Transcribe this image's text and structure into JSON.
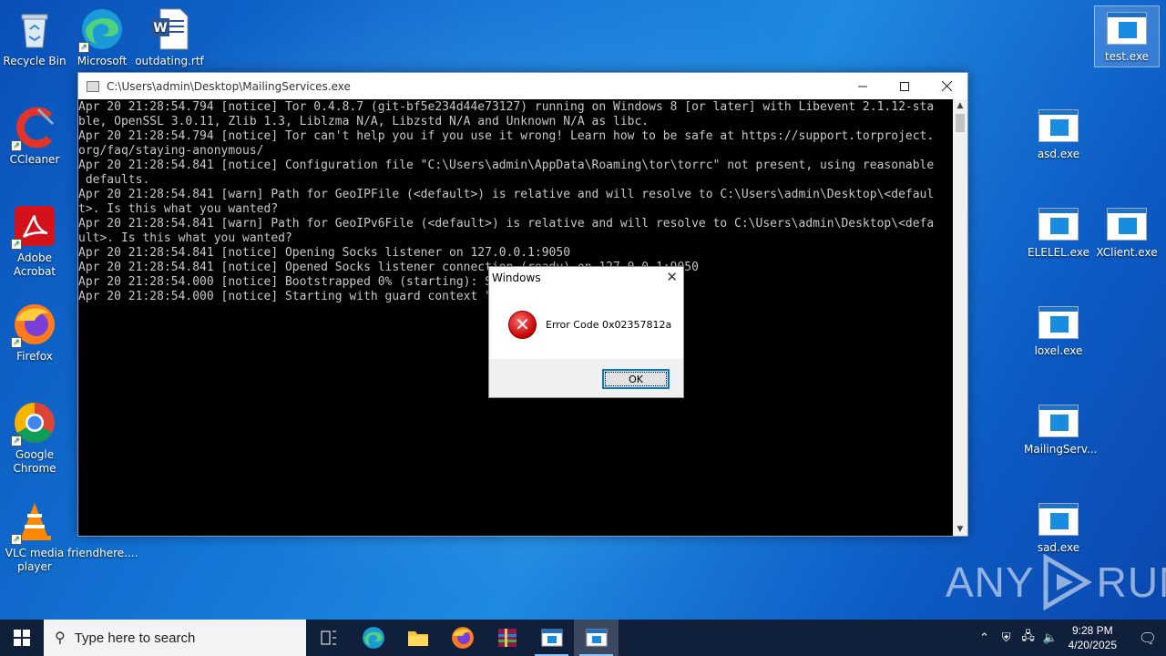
{
  "desktop": {
    "icons_left": [
      {
        "label": "Recycle Bin",
        "icon": "recycle-bin-icon"
      },
      {
        "label": "Microsoft Edge",
        "icon": "edge-icon"
      },
      {
        "label": "outdating.rtf",
        "icon": "word-document-icon"
      },
      {
        "label": "CCleaner",
        "icon": "ccleaner-icon"
      },
      {
        "label": "Adobe Acrobat",
        "icon": "acrobat-icon"
      },
      {
        "label": "Firefox",
        "icon": "firefox-icon"
      },
      {
        "label": "Google Chrome",
        "icon": "chrome-icon"
      },
      {
        "label": "VLC media player",
        "icon": "vlc-icon"
      },
      {
        "label": "friendhere....",
        "icon": "file-icon"
      }
    ],
    "icons_right": [
      {
        "label": "test.exe"
      },
      {
        "label": "asd.exe"
      },
      {
        "label": "ELELEL.exe"
      },
      {
        "label": "XClient.exe"
      },
      {
        "label": "loxel.exe"
      },
      {
        "label": "MailingServ..."
      },
      {
        "label": "sad.exe"
      }
    ]
  },
  "console": {
    "title": "C:\\Users\\admin\\Desktop\\MailingServices.exe",
    "lines": [
      "Apr 20 21:28:54.794 [notice] Tor 0.4.8.7 (git-bf5e234d44e73127) running on Windows 8 [or later] with Libevent 2.1.12-sta",
      "ble, OpenSSL 3.0.11, Zlib 1.3, Liblzma N/A, Libzstd N/A and Unknown N/A as libc.",
      "Apr 20 21:28:54.794 [notice] Tor can't help you if you use it wrong! Learn how to be safe at https://support.torproject.",
      "org/faq/staying-anonymous/",
      "Apr 20 21:28:54.841 [notice] Configuration file \"C:\\Users\\admin\\AppData\\Roaming\\tor\\torrc\" not present, using reasonable",
      " defaults.",
      "Apr 20 21:28:54.841 [warn] Path for GeoIPFile (<default>) is relative and will resolve to C:\\Users\\admin\\Desktop\\<defaul",
      "t>. Is this what you wanted?",
      "Apr 20 21:28:54.841 [warn] Path for GeoIPv6File (<default>) is relative and will resolve to C:\\Users\\admin\\Desktop\\<defa",
      "ult>. Is this what you wanted?",
      "Apr 20 21:28:54.841 [notice] Opening Socks listener on 127.0.0.1:9050",
      "Apr 20 21:28:54.841 [notice] Opened Socks listener connection (ready) on 127.0.0.1:9050",
      "Apr 20 21:28:54.000 [notice] Bootstrapped 0% (starting): Starting",
      "Apr 20 21:28:54.000 [notice] Starting with guard context \"default\""
    ]
  },
  "dialog": {
    "title": "Windows",
    "close": "✕",
    "message": "Error Code 0x02357812a",
    "ok_label": "OK"
  },
  "watermark": {
    "left": "ANY",
    "right": "RUN"
  },
  "taskbar": {
    "search_placeholder": "Type here to search",
    "time": "9:28 PM",
    "date": "4/20/2025"
  }
}
